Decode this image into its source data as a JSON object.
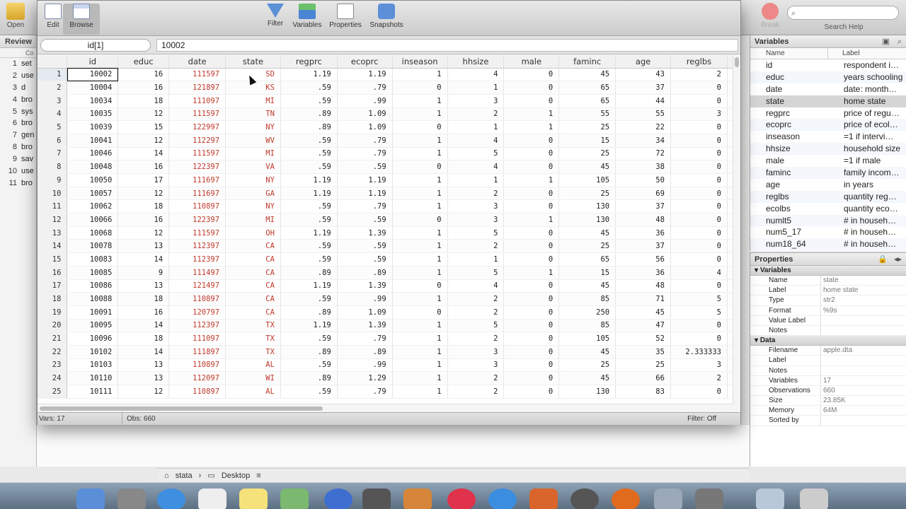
{
  "main_toolbar": {
    "open_label": "Open",
    "break_label": "Break",
    "search_placeholder": "",
    "search_label": "Search Help"
  },
  "review": {
    "title": "Review",
    "sub_header": "Co",
    "items": [
      {
        "n": "1",
        "cmd": "set"
      },
      {
        "n": "2",
        "cmd": "use"
      },
      {
        "n": "3",
        "cmd": "d"
      },
      {
        "n": "4",
        "cmd": "bro"
      },
      {
        "n": "5",
        "cmd": "sys"
      },
      {
        "n": "6",
        "cmd": "bro"
      },
      {
        "n": "7",
        "cmd": "gen"
      },
      {
        "n": "8",
        "cmd": "bro"
      },
      {
        "n": "9",
        "cmd": "sav"
      },
      {
        "n": "10",
        "cmd": "use"
      },
      {
        "n": "11",
        "cmd": "bro"
      }
    ]
  },
  "editor_toolbar": {
    "edit": "Edit",
    "browse": "Browse",
    "filter": "Filter",
    "variables": "Variables",
    "properties": "Properties",
    "snapshots": "Snapshots"
  },
  "cell_ref": "id[1]",
  "cell_value": "10002",
  "grid": {
    "columns": [
      "id",
      "educ",
      "date",
      "state",
      "regprc",
      "ecoprc",
      "inseason",
      "hhsize",
      "male",
      "faminc",
      "age",
      "reglbs"
    ],
    "rows": [
      [
        "10002",
        "16",
        "111597",
        "SD",
        "1.19",
        "1.19",
        "1",
        "4",
        "0",
        "45",
        "43",
        "2"
      ],
      [
        "10004",
        "16",
        "121897",
        "KS",
        ".59",
        ".79",
        "0",
        "1",
        "0",
        "65",
        "37",
        "0"
      ],
      [
        "10034",
        "18",
        "111097",
        "MI",
        ".59",
        ".99",
        "1",
        "3",
        "0",
        "65",
        "44",
        "0"
      ],
      [
        "10035",
        "12",
        "111597",
        "TN",
        ".89",
        "1.09",
        "1",
        "2",
        "1",
        "55",
        "55",
        "3"
      ],
      [
        "10039",
        "15",
        "122997",
        "NY",
        ".89",
        "1.09",
        "0",
        "1",
        "1",
        "25",
        "22",
        "0"
      ],
      [
        "10041",
        "12",
        "112297",
        "WV",
        ".59",
        ".79",
        "1",
        "4",
        "0",
        "15",
        "34",
        "0"
      ],
      [
        "10046",
        "14",
        "111597",
        "MI",
        ".59",
        ".79",
        "1",
        "5",
        "0",
        "25",
        "72",
        "0"
      ],
      [
        "10048",
        "16",
        "122397",
        "VA",
        ".59",
        ".59",
        "0",
        "4",
        "0",
        "45",
        "38",
        "0"
      ],
      [
        "10050",
        "17",
        "111697",
        "NY",
        "1.19",
        "1.19",
        "1",
        "1",
        "1",
        "105",
        "50",
        "0"
      ],
      [
        "10057",
        "12",
        "111697",
        "GA",
        "1.19",
        "1.19",
        "1",
        "2",
        "0",
        "25",
        "69",
        "0"
      ],
      [
        "10062",
        "18",
        "110897",
        "NY",
        ".59",
        ".79",
        "1",
        "3",
        "0",
        "130",
        "37",
        "0"
      ],
      [
        "10066",
        "16",
        "122397",
        "MI",
        ".59",
        ".59",
        "0",
        "3",
        "1",
        "130",
        "48",
        "0"
      ],
      [
        "10068",
        "12",
        "111597",
        "OH",
        "1.19",
        "1.39",
        "1",
        "5",
        "0",
        "45",
        "36",
        "0"
      ],
      [
        "10078",
        "13",
        "112397",
        "CA",
        ".59",
        ".59",
        "1",
        "2",
        "0",
        "25",
        "37",
        "0"
      ],
      [
        "10083",
        "14",
        "112397",
        "CA",
        ".59",
        ".59",
        "1",
        "1",
        "0",
        "65",
        "56",
        "0"
      ],
      [
        "10085",
        "9",
        "111497",
        "CA",
        ".89",
        ".89",
        "1",
        "5",
        "1",
        "15",
        "36",
        "4"
      ],
      [
        "10086",
        "13",
        "121497",
        "CA",
        "1.19",
        "1.39",
        "0",
        "4",
        "0",
        "45",
        "48",
        "0"
      ],
      [
        "10088",
        "18",
        "110897",
        "CA",
        ".59",
        ".99",
        "1",
        "2",
        "0",
        "85",
        "71",
        "5"
      ],
      [
        "10091",
        "16",
        "120797",
        "CA",
        ".89",
        "1.09",
        "0",
        "2",
        "0",
        "250",
        "45",
        "5"
      ],
      [
        "10095",
        "14",
        "112397",
        "TX",
        "1.19",
        "1.39",
        "1",
        "5",
        "0",
        "85",
        "47",
        "0"
      ],
      [
        "10096",
        "18",
        "111097",
        "TX",
        ".59",
        ".79",
        "1",
        "2",
        "0",
        "105",
        "52",
        "0"
      ],
      [
        "10102",
        "14",
        "111897",
        "TX",
        ".89",
        ".89",
        "1",
        "3",
        "0",
        "45",
        "35",
        "2.333333"
      ],
      [
        "10103",
        "13",
        "110897",
        "AL",
        ".59",
        ".99",
        "1",
        "3",
        "0",
        "25",
        "25",
        "3"
      ],
      [
        "10110",
        "13",
        "112097",
        "WI",
        ".89",
        "1.29",
        "1",
        "2",
        "0",
        "45",
        "66",
        "2"
      ],
      [
        "10111",
        "12",
        "110897",
        "AL",
        ".59",
        ".79",
        "1",
        "2",
        "0",
        "130",
        "83",
        "0"
      ]
    ],
    "string_columns": [
      2,
      3
    ]
  },
  "status": {
    "vars": "Vars: 17",
    "obs": "Obs: 660",
    "filter": "Filter: Off"
  },
  "path": {
    "user": "stata",
    "folder": "Desktop"
  },
  "variables_panel": {
    "title": "Variables",
    "col_name": "Name",
    "col_label": "Label",
    "items": [
      {
        "name": "id",
        "label": "respondent i…"
      },
      {
        "name": "educ",
        "label": "years schooling"
      },
      {
        "name": "date",
        "label": "date:  month…"
      },
      {
        "name": "state",
        "label": "home state"
      },
      {
        "name": "regprc",
        "label": "price of regu…"
      },
      {
        "name": "ecoprc",
        "label": "price of ecol…"
      },
      {
        "name": "inseason",
        "label": "=1 if intervi…"
      },
      {
        "name": "hhsize",
        "label": "household size"
      },
      {
        "name": "male",
        "label": "=1 if male"
      },
      {
        "name": "faminc",
        "label": "family incom…"
      },
      {
        "name": "age",
        "label": "in years"
      },
      {
        "name": "reglbs",
        "label": "quantity reg…"
      },
      {
        "name": "ecolbs",
        "label": "quantity eco…"
      },
      {
        "name": "numlt5",
        "label": "# in househ…"
      },
      {
        "name": "num5_17",
        "label": "# in househ…"
      },
      {
        "name": "num18_64",
        "label": "# in househ…"
      }
    ]
  },
  "properties_panel": {
    "title": "Properties",
    "sec_variables": "Variables",
    "variables": [
      {
        "k": "Name",
        "v": "state"
      },
      {
        "k": "Label",
        "v": "home state"
      },
      {
        "k": "Type",
        "v": "str2"
      },
      {
        "k": "Format",
        "v": "%9s"
      },
      {
        "k": "Value Label",
        "v": ""
      },
      {
        "k": "Notes",
        "v": ""
      }
    ],
    "sec_data": "Data",
    "data": [
      {
        "k": "Filename",
        "v": "apple.dta"
      },
      {
        "k": "Label",
        "v": ""
      },
      {
        "k": "Notes",
        "v": ""
      },
      {
        "k": "Variables",
        "v": "17"
      },
      {
        "k": "Observations",
        "v": "660"
      },
      {
        "k": "Size",
        "v": "23.85K"
      },
      {
        "k": "Memory",
        "v": "64M"
      },
      {
        "k": "Sorted by",
        "v": ""
      }
    ]
  },
  "colors": {
    "string_text": "#c0392b",
    "selected_row": "#d5d5d5"
  }
}
